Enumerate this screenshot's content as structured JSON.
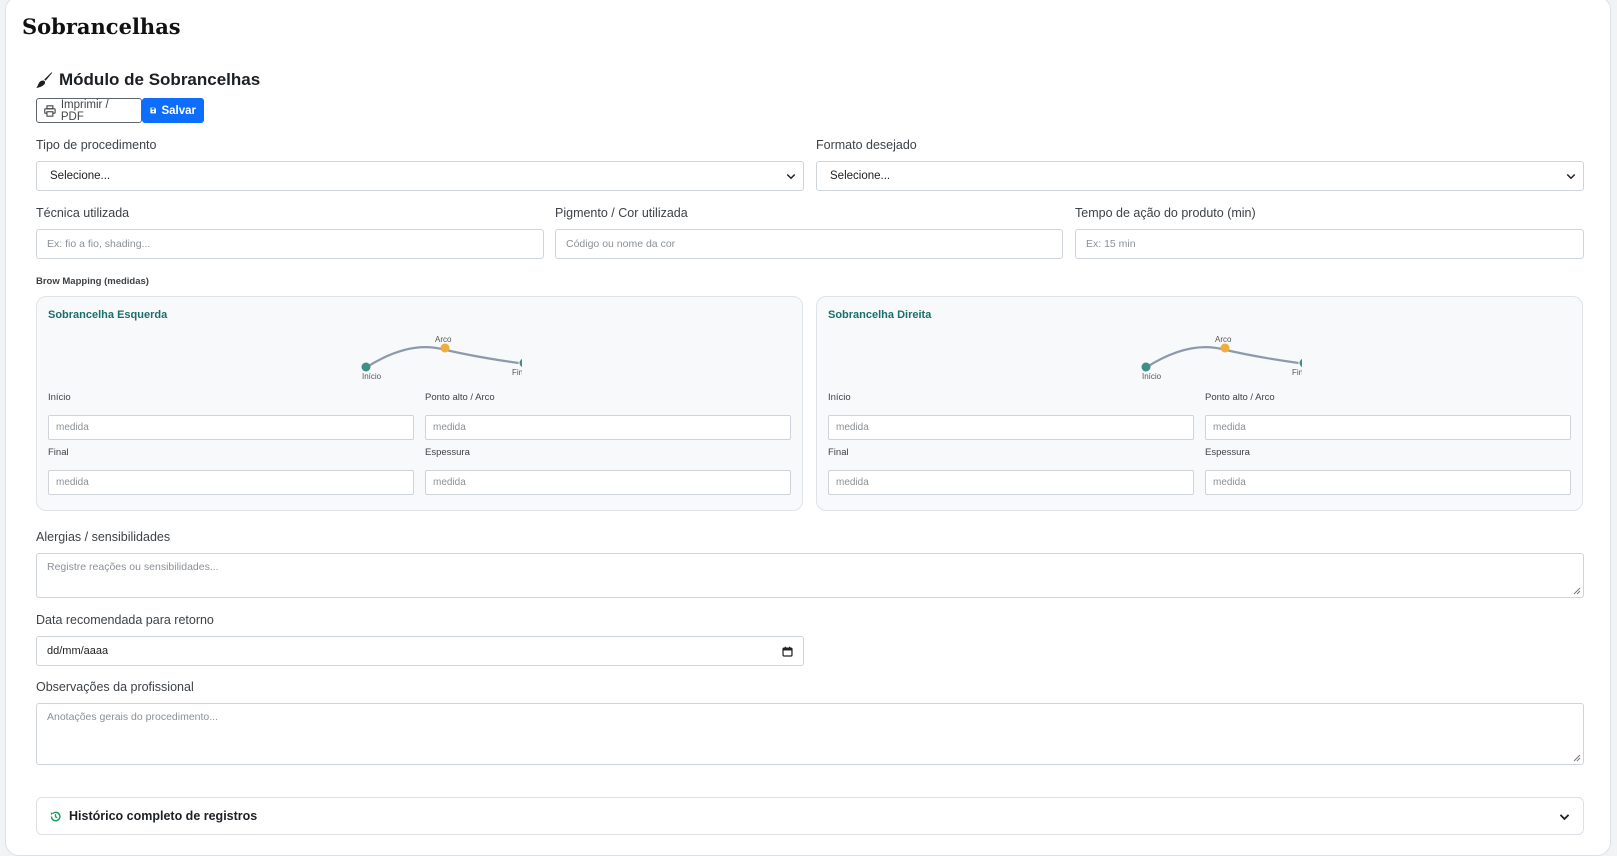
{
  "page": {
    "title": "Sobrancelhas"
  },
  "module": {
    "title": "Módulo de Sobrancelhas"
  },
  "toolbar": {
    "print_label": "Imprimir / PDF",
    "save_label": "Salvar"
  },
  "fields": {
    "procedure_type": {
      "label": "Tipo de procedimento",
      "value": "Selecione..."
    },
    "desired_shape": {
      "label": "Formato desejado",
      "value": "Selecione..."
    },
    "technique": {
      "label": "Técnica utilizada",
      "placeholder": "Ex: fio a fio, shading..."
    },
    "pigment": {
      "label": "Pigmento / Cor utilizada",
      "placeholder": "Código ou nome da cor"
    },
    "action_time": {
      "label": "Tempo de ação do produto (min)",
      "placeholder": "Ex: 15 min"
    }
  },
  "brow_mapping": {
    "heading": "Brow Mapping (medidas)",
    "diagram_labels": {
      "start": "Início",
      "arch": "Arco",
      "end": "Final"
    },
    "measure_labels": {
      "start": "Início",
      "arch": "Ponto alto / Arco",
      "end": "Final",
      "thickness": "Espessura"
    },
    "measure_placeholder": "medida",
    "left": {
      "title": "Sobrancelha Esquerda"
    },
    "right": {
      "title": "Sobrancelha Direita"
    }
  },
  "allergies": {
    "label": "Alergias / sensibilidades",
    "placeholder": "Registre reações ou sensibilidades..."
  },
  "return_date": {
    "label": "Data recomendada para retorno",
    "value": "dd/mm/aaaa"
  },
  "notes": {
    "label": "Observações da profissional",
    "placeholder": "Anotações gerais do procedimento..."
  },
  "history": {
    "label": "Histórico completo de registros"
  },
  "colors": {
    "accent": "#0d6efd",
    "teal": "#1b6f6a",
    "node_teal": "#3f8f86",
    "node_orange": "#f0ad3e",
    "curve": "#8d9aab"
  },
  "icons": [
    "brush-icon",
    "printer-icon",
    "save-icon",
    "chevron-down-icon",
    "calendar-icon",
    "history-icon",
    "resize-grip-icon"
  ]
}
